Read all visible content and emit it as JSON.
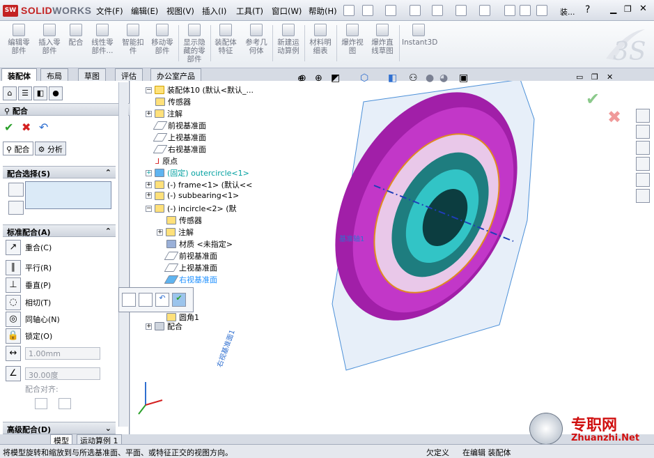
{
  "app": {
    "logo_prefix": "SW",
    "logo_brand": "SOLID",
    "logo_rest": "WORKS",
    "doc_title": "装..."
  },
  "menu": [
    "文件(F)",
    "编辑(E)",
    "视图(V)",
    "插入(I)",
    "工具(T)",
    "窗口(W)",
    "帮助(H)"
  ],
  "ribbon": [
    {
      "label": "编辑零\n部件"
    },
    {
      "label": "插入零\n部件"
    },
    {
      "label": "配合"
    },
    {
      "label": "线性零\n部件..."
    },
    {
      "label": "智能扣\n件"
    },
    {
      "label": "移动零\n部件"
    },
    {
      "label": "显示隐\n藏的零\n部件"
    },
    {
      "label": "装配体\n特征"
    },
    {
      "label": "参考几\n何体"
    },
    {
      "label": "新建运\n动算例"
    },
    {
      "label": "材料明\n细表"
    },
    {
      "label": "爆炸视\n图"
    },
    {
      "label": "爆炸直\n线草图"
    },
    {
      "label": "Instant3D"
    }
  ],
  "tabs": [
    "装配体",
    "布局",
    "草图",
    "评估",
    "办公室产品"
  ],
  "panel": {
    "title": "配合",
    "help": "?",
    "subtabs": [
      "配合",
      "分析"
    ],
    "mate_selection": "配合选择(S)",
    "standard_mates": "标准配合(A)",
    "mates": [
      "重合(C)",
      "平行(R)",
      "垂直(P)",
      "相切(T)",
      "同轴心(N)",
      "锁定(O)"
    ],
    "distance_value": "1.00mm",
    "angle_value": "30.00度",
    "mate_alignment": "配合对齐:",
    "advanced": "高级配合(D)"
  },
  "bottom_tabs": [
    "模型",
    "运动算例 1"
  ],
  "tree": [
    {
      "label": "装配体10  (默认<默认_...",
      "level": 0
    },
    {
      "label": "传感器",
      "level": 1
    },
    {
      "label": "注解",
      "level": 1
    },
    {
      "label": "前视基准面",
      "level": 1
    },
    {
      "label": "上视基准面",
      "level": 1
    },
    {
      "label": "右视基准面",
      "level": 1
    },
    {
      "label": "原点",
      "level": 1
    },
    {
      "label": "(固定) outercircle<1>",
      "level": 1
    },
    {
      "label": "(-) frame<1> (默认<<",
      "level": 1
    },
    {
      "label": "(-) subbearing<1>",
      "level": 1
    },
    {
      "label": "(-) incircle<2> (默",
      "level": 1
    },
    {
      "label": "传感器",
      "level": 2
    },
    {
      "label": "注解",
      "level": 2
    },
    {
      "label": "材质 <未指定>",
      "level": 2
    },
    {
      "label": "前视基准面",
      "level": 2
    },
    {
      "label": "上视基准面",
      "level": 2
    },
    {
      "label": "右视基准面",
      "level": 2
    },
    {
      "label": "圆角1",
      "level": 2
    },
    {
      "label": "配合",
      "level": 1
    }
  ],
  "viewport_labels": {
    "axis": "基准轴1",
    "plane": "右视基准面1"
  },
  "status": {
    "hint": "将模型旋转和缩放到与所选基准面、平面、或特征正交的视图方向。",
    "undef": "欠定义",
    "editing": "在编辑 装配体"
  },
  "watermark": {
    "cn": "专职网",
    "url": "Zhuanzhi.Net"
  },
  "colors": {
    "accept": "#2aa02a",
    "cancel": "#d42020",
    "part": "#b020b0",
    "teal": "#20b0b0",
    "accent": "#2f6fd0"
  }
}
